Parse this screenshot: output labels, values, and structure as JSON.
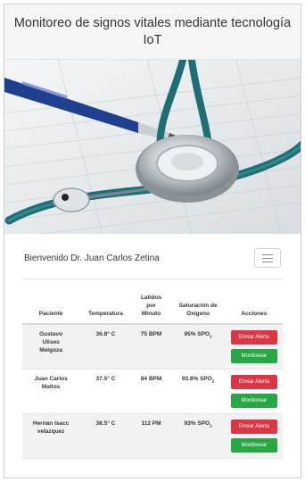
{
  "header": {
    "title": "Monitoreo de signos vitales mediante tecnología IoT"
  },
  "hero": {
    "image": "stethoscope-and-pen-on-medical-chart-photo"
  },
  "navbar": {
    "welcome": "Bienvenido Dr. Juan Carlos Zetina",
    "menu_icon": "hamburger-menu-icon"
  },
  "table": {
    "headers": {
      "patient": "Paciente",
      "temperature": "Temperatura",
      "heart_rate": "Latidos por Minuto",
      "oxygen": "Saturación de Oxígeno",
      "actions": "Acciones"
    },
    "rows": [
      {
        "patient": "Gustavo Ulises Melgoza",
        "temperature": "36.8° C",
        "heart_rate": "75 BPM",
        "oxygen": "95% SPO",
        "oxygen_sub": "2"
      },
      {
        "patient": "Juan Carlos Maltos",
        "temperature": "37.5° C",
        "heart_rate": "84 BPM",
        "oxygen": "93.8% SPO",
        "oxygen_sub": "2"
      },
      {
        "patient": "Hernán Isacc velazquez",
        "temperature": "38.5° C",
        "heart_rate": "112 PM",
        "oxygen": "93% SPO",
        "oxygen_sub": "2"
      }
    ],
    "alert_label": "Enviar Alerta",
    "monitor_label": "Monitorear"
  },
  "colors": {
    "alert": "#dc3545",
    "monitor": "#28a745",
    "header_bg": "#f5f5f5",
    "stripe": "#f2f2f2"
  }
}
